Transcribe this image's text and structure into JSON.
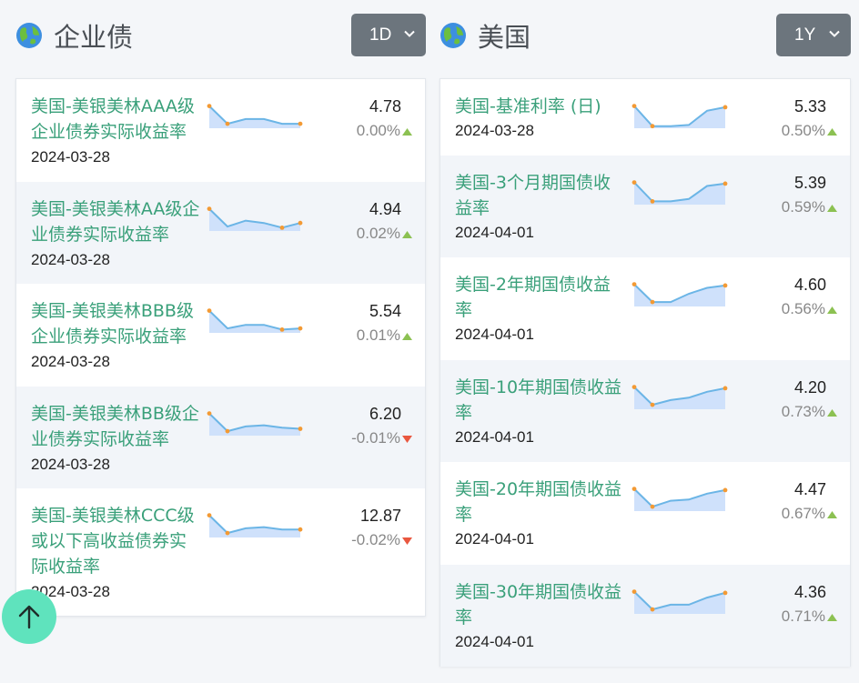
{
  "colors": {
    "accent_green": "#3aa07a",
    "up": "#8cc152",
    "down": "#e9573f",
    "spark_line": "#6bb5e6",
    "spark_fill": "#cfe1fb",
    "spark_dot": "#f39a34"
  },
  "left": {
    "title": "企业债",
    "period": "1D",
    "rows": [
      {
        "name_lines": [
          "美国-美银美林AAA级",
          "企业债券实际收益率"
        ],
        "date": "2024-03-28",
        "value": "4.78",
        "change": "0.00%",
        "dir": "up",
        "spark": [
          0.9,
          0.15,
          0.35,
          0.35,
          0.15,
          0.15
        ]
      },
      {
        "name_lines": [
          "美国-美银美林AA级企",
          "业债券实际收益率"
        ],
        "date": "2024-03-28",
        "value": "4.94",
        "change": "0.02%",
        "dir": "up",
        "spark": [
          0.9,
          0.15,
          0.4,
          0.3,
          0.1,
          0.3
        ]
      },
      {
        "name_lines": [
          "美国-美银美林BBB级",
          "企业债券实际收益率"
        ],
        "date": "2024-03-28",
        "value": "5.54",
        "change": "0.01%",
        "dir": "up",
        "spark": [
          0.9,
          0.15,
          0.3,
          0.3,
          0.1,
          0.15
        ]
      },
      {
        "name_lines": [
          "美国-美银美林BB级企",
          "业债券实际收益率"
        ],
        "date": "2024-03-28",
        "value": "6.20",
        "change": "-0.01%",
        "dir": "down",
        "spark": [
          0.9,
          0.15,
          0.35,
          0.4,
          0.3,
          0.25
        ]
      },
      {
        "name_lines": [
          "美国-美银美林CCC级",
          "或以下高收益债券实",
          "际收益率"
        ],
        "date": "2024-03-28",
        "value": "12.87",
        "change": "-0.02%",
        "dir": "down",
        "spark": [
          0.9,
          0.15,
          0.35,
          0.4,
          0.3,
          0.3
        ]
      }
    ]
  },
  "right": {
    "title": "美国",
    "period": "1Y",
    "rows": [
      {
        "name_lines": [
          "美国-基准利率 (日)"
        ],
        "date": "2024-03-28",
        "value": "5.33",
        "change": "0.50%",
        "dir": "up",
        "spark": [
          0.9,
          0.05,
          0.05,
          0.1,
          0.7,
          0.85
        ]
      },
      {
        "name_lines": [
          "美国-3个月期国债收",
          "益率"
        ],
        "date": "2024-04-01",
        "value": "5.39",
        "change": "0.59%",
        "dir": "up",
        "spark": [
          0.9,
          0.1,
          0.1,
          0.2,
          0.75,
          0.85
        ]
      },
      {
        "name_lines": [
          "美国-2年期国债收益",
          "率"
        ],
        "date": "2024-04-01",
        "value": "4.60",
        "change": "0.56%",
        "dir": "up",
        "spark": [
          0.9,
          0.15,
          0.15,
          0.5,
          0.75,
          0.85
        ]
      },
      {
        "name_lines": [
          "美国-10年期国债收益",
          "率"
        ],
        "date": "2024-04-01",
        "value": "4.20",
        "change": "0.73%",
        "dir": "up",
        "spark": [
          0.9,
          0.15,
          0.35,
          0.45,
          0.7,
          0.85
        ]
      },
      {
        "name_lines": [
          "美国-20年期国债收益",
          "率"
        ],
        "date": "2024-04-01",
        "value": "4.47",
        "change": "0.67%",
        "dir": "up",
        "spark": [
          0.9,
          0.15,
          0.4,
          0.45,
          0.7,
          0.85
        ]
      },
      {
        "name_lines": [
          "美国-30年期国债收益",
          "率"
        ],
        "date": "2024-04-01",
        "value": "4.36",
        "change": "0.71%",
        "dir": "up",
        "spark": [
          0.9,
          0.15,
          0.35,
          0.35,
          0.65,
          0.85
        ]
      }
    ]
  }
}
